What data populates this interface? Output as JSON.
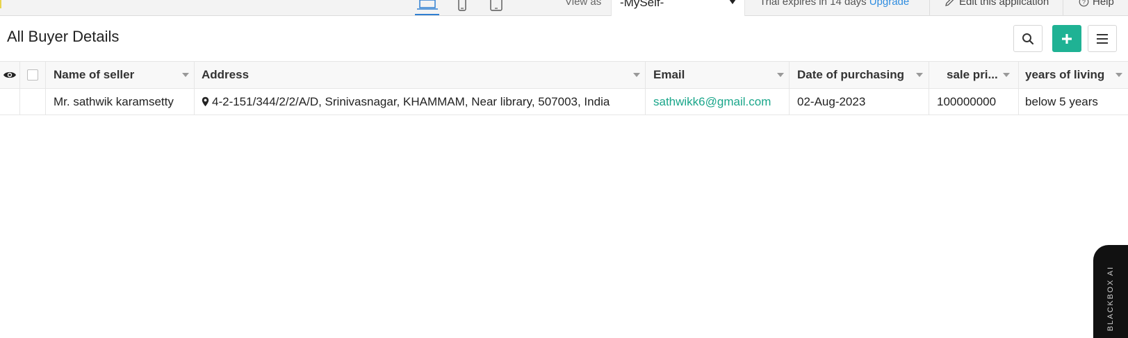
{
  "topbar": {
    "view_as_label": "View as",
    "view_as_value": "-MySelf-",
    "trial_text": "Trial expires in 14 days",
    "upgrade_link": "Upgrade",
    "edit_app_label": "Edit this application",
    "help_label": "Help"
  },
  "page": {
    "title": "All Buyer Details"
  },
  "table": {
    "columns": [
      {
        "label": "Name of seller"
      },
      {
        "label": "Address"
      },
      {
        "label": "Email"
      },
      {
        "label": "Date of purchasing"
      },
      {
        "label": "sale pri..."
      },
      {
        "label": "years of living"
      }
    ],
    "rows": [
      {
        "name_of_seller": "Mr. sathwik karamsetty",
        "address": "4-2-151/344/2/2/A/D, Srinivasnagar, KHAMMAM, Near library, 507003, India",
        "email": "sathwikk6@gmail.com",
        "date_of_purchasing": "02-Aug-2023",
        "sale_price": "100000000",
        "years_of_living": "below 5 years"
      }
    ]
  },
  "blackbox_tab": {
    "label": "BLACKBOX AI"
  },
  "colors": {
    "accent_green": "#1fb294",
    "link_blue": "#2f8de0",
    "email_green": "#1aa68a"
  },
  "icons": {
    "desktop": "desktop-icon",
    "mobile": "mobile-icon",
    "tablet": "tablet-icon",
    "edit": "pencil-icon",
    "help": "help-circle-icon",
    "search": "search-icon",
    "add": "plus-icon",
    "menu": "hamburger-menu-icon",
    "visibility": "eye-icon",
    "location": "map-pin-icon"
  }
}
